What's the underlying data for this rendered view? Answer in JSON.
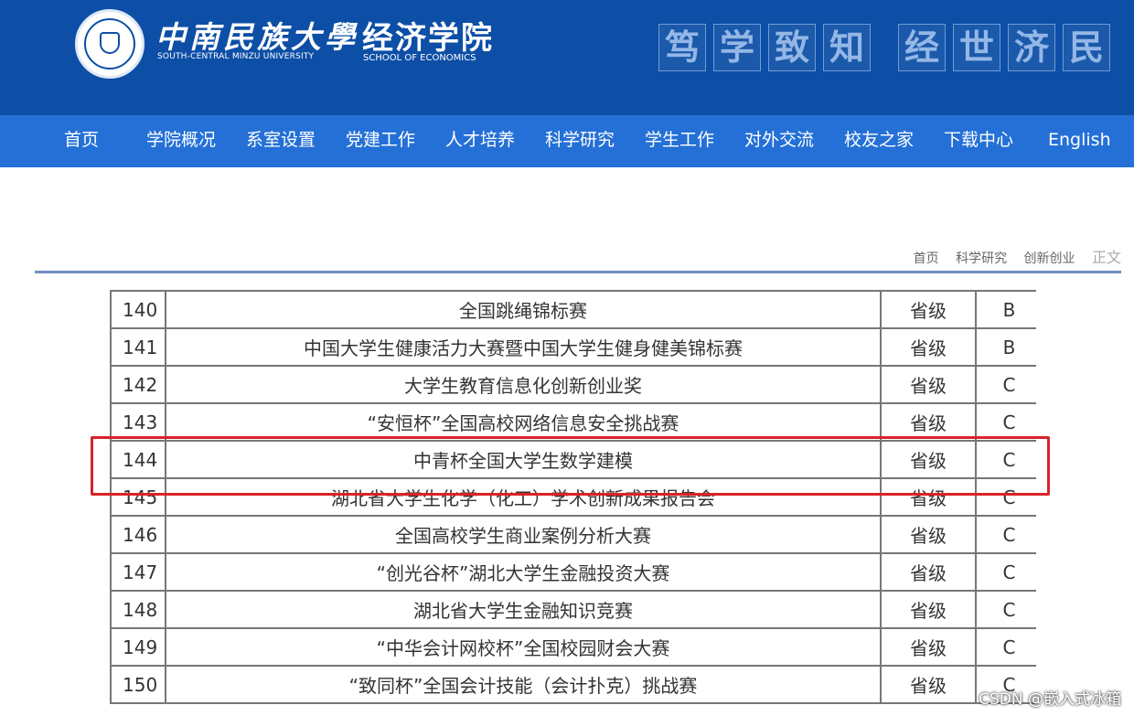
{
  "header": {
    "university_cn": "中南民族大學",
    "university_en": "SOUTH-CENTRAL MINZU UNIVERSITY",
    "school_cn": "经济学院",
    "school_en": "SCHOOL OF ECONOMICS",
    "motto_left": [
      "笃",
      "学",
      "致",
      "知"
    ],
    "motto_right": [
      "经",
      "世",
      "济",
      "民"
    ]
  },
  "nav": [
    "首页",
    "学院概况",
    "系室设置",
    "党建工作",
    "人才培养",
    "科学研究",
    "学生工作",
    "对外交流",
    "校友之家",
    "下载中心",
    "English"
  ],
  "breadcrumb": [
    "首页",
    "科学研究",
    "创新创业",
    "正文"
  ],
  "table": {
    "rows": [
      {
        "no": "140",
        "name": "全国跳绳锦标赛",
        "level": "省级",
        "grade": "B"
      },
      {
        "no": "141",
        "name": "中国大学生健康活力大赛暨中国大学生健身健美锦标赛",
        "level": "省级",
        "grade": "B"
      },
      {
        "no": "142",
        "name": "大学生教育信息化创新创业奖",
        "level": "省级",
        "grade": "C"
      },
      {
        "no": "143",
        "name": "“安恒杯”全国高校网络信息安全挑战赛",
        "level": "省级",
        "grade": "C"
      },
      {
        "no": "144",
        "name": "中青杯全国大学生数学建模",
        "level": "省级",
        "grade": "C"
      },
      {
        "no": "145",
        "name": "湖北省大学生化学（化工）学术创新成果报告会",
        "level": "省级",
        "grade": "C"
      },
      {
        "no": "146",
        "name": "全国高校学生商业案例分析大赛",
        "level": "省级",
        "grade": "C"
      },
      {
        "no": "147",
        "name": "“创光谷杯”湖北大学生金融投资大赛",
        "level": "省级",
        "grade": "C"
      },
      {
        "no": "148",
        "name": "湖北省大学生金融知识竞赛",
        "level": "省级",
        "grade": "C"
      },
      {
        "no": "149",
        "name": "“中华会计网校杯”全国校园财会大赛",
        "level": "省级",
        "grade": "C"
      },
      {
        "no": "150",
        "name": "“致同杯”全国会计技能（会计扑克）挑战赛",
        "level": "省级",
        "grade": "C"
      }
    ]
  },
  "watermark": "CSDN @嵌入式冰箱",
  "colors": {
    "header_bg": "#0d4fa6",
    "nav_bg": "#2470d6",
    "highlight": "#d8232a"
  }
}
